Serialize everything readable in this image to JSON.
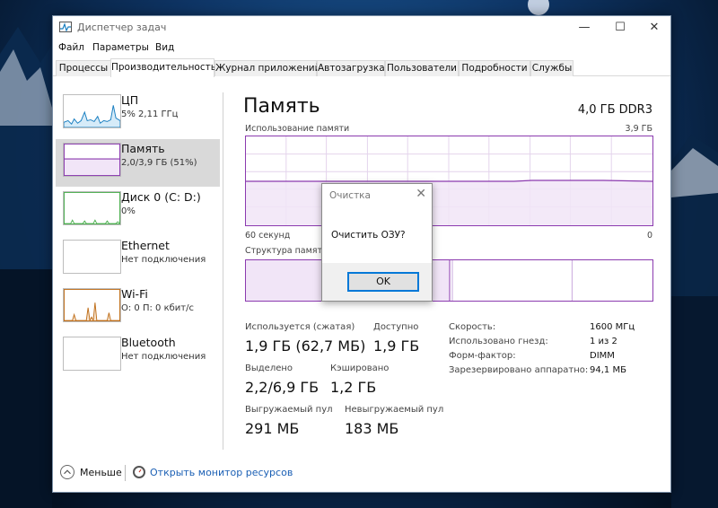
{
  "window": {
    "title": "Диспетчер задач"
  },
  "menu": [
    "Файл",
    "Параметры",
    "Вид"
  ],
  "tabs": [
    "Процессы",
    "Производительность",
    "Журнал приложений",
    "Автозагрузка",
    "Пользователи",
    "Подробности",
    "Службы"
  ],
  "sidebar": {
    "items": [
      {
        "name": "ЦП",
        "sub": "5% 2,11 ГГц"
      },
      {
        "name": "Память",
        "sub": "2,0/3,9 ГБ (51%)"
      },
      {
        "name": "Диск 0 (C: D:)",
        "sub": "0%"
      },
      {
        "name": "Ethernet",
        "sub": "Нет подключения"
      },
      {
        "name": "Wi-Fi",
        "sub": "О: 0 П: 0 кбит/с"
      },
      {
        "name": "Bluetooth",
        "sub": "Нет подключения"
      }
    ]
  },
  "main": {
    "title": "Память",
    "spec": "4,0 ГБ DDR3",
    "usage_label": "Использование памяти",
    "usage_max": "3,9 ГБ",
    "axis_left": "60 секунд",
    "axis_right": "0",
    "structure_label": "Структура памяти"
  },
  "stats": {
    "in_use_label": "Используется (сжатая)",
    "in_use_value": "1,9 ГБ (62,7 МБ)",
    "available_label": "Доступно",
    "available_value": "1,9 ГБ",
    "committed_label": "Выделено",
    "committed_value": "2,2/6,9 ГБ",
    "cached_label": "Кэшировано",
    "cached_value": "1,2 ГБ",
    "paged_label": "Выгружаемый пул",
    "paged_value": "291 МБ",
    "nonpaged_label": "Невыгружаемый пул",
    "nonpaged_value": "183 МБ"
  },
  "specs": [
    {
      "label": "Скорость:",
      "value": "1600 МГц"
    },
    {
      "label": "Использовано гнезд:",
      "value": "1 из 2"
    },
    {
      "label": "Форм-фактор:",
      "value": "DIMM"
    },
    {
      "label": "Зарезервировано аппаратно:",
      "value": "94,1 МБ"
    }
  ],
  "footer": {
    "fewer": "Меньше",
    "monitor": "Открыть монитор ресурсов"
  },
  "dialog": {
    "title": "Очистка",
    "message": "Очистить ОЗУ?",
    "ok": "OK"
  },
  "colors": {
    "memory_accent": "#8b3aaf",
    "cpu_accent": "#1a7fc1",
    "disk_accent": "#4caf50",
    "wifi_accent": "#c0701c"
  }
}
